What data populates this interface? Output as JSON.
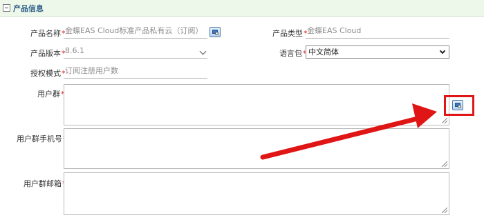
{
  "section": {
    "title": "产品信息"
  },
  "form": {
    "product_name": {
      "label": "产品名称",
      "required_mark": "*",
      "value": "金蝶EAS Cloud标准产品私有云（订阅）"
    },
    "product_type": {
      "label": "产品类型",
      "required_mark": "*",
      "value": "金蝶EAS Cloud"
    },
    "product_version": {
      "label": "产品版本",
      "required_mark": "*",
      "value": "8.6.1"
    },
    "language_pack": {
      "label": "语言包",
      "required_mark": "*",
      "value": "中文简体"
    },
    "license_mode": {
      "label": "授权模式",
      "required_mark": "*",
      "placeholder": "订阅注册用户数"
    },
    "user_group": {
      "label": "用户群",
      "required_mark": "*",
      "value": ""
    },
    "user_group_phone": {
      "label": "用户群手机号",
      "required_mark": "*",
      "value": ""
    },
    "user_group_email": {
      "label": "用户群邮箱",
      "required_mark": "*",
      "value": ""
    }
  },
  "icons": {
    "collapse": "minus-square-icon",
    "picker": "lookup-picker-icon",
    "resize": "resize-grip-icon",
    "select_arrow": "chevron-down-icon"
  },
  "annotation": {
    "highlight_color": "#e01515",
    "arrow_color": "#e01515"
  }
}
